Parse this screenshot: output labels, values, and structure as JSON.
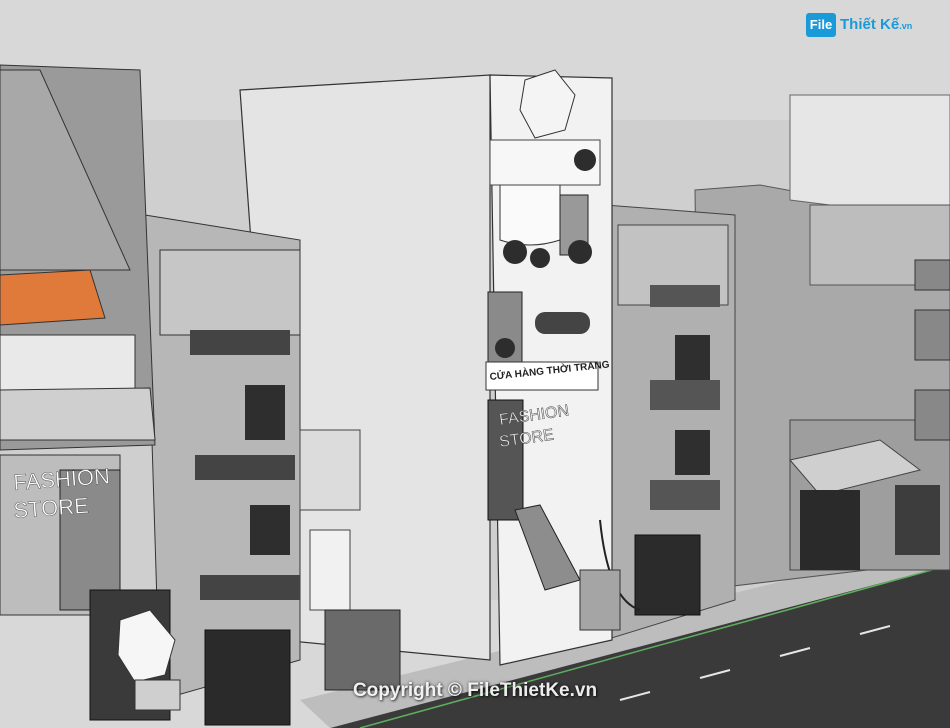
{
  "logo": {
    "box": "File",
    "name": "Thiết Kế",
    "suffix": ".vn"
  },
  "signage": {
    "left_store_line1": "FASHION",
    "left_store_line2": "STORE",
    "center_sign_title": "CỬA HÀNG THỜI TRANG",
    "center_store_line1": "FASHION",
    "center_store_line2": "STORE"
  },
  "watermark": "Copyright © FileThietKe.vn",
  "colors": {
    "sky": "#d8d8d8",
    "road": "#3a3a3a",
    "road_line": "#5fae5f",
    "glass": "#b7b7b7",
    "wall": "#ececec",
    "awning": "#e07a3a",
    "logo": "#1a9ad8"
  }
}
